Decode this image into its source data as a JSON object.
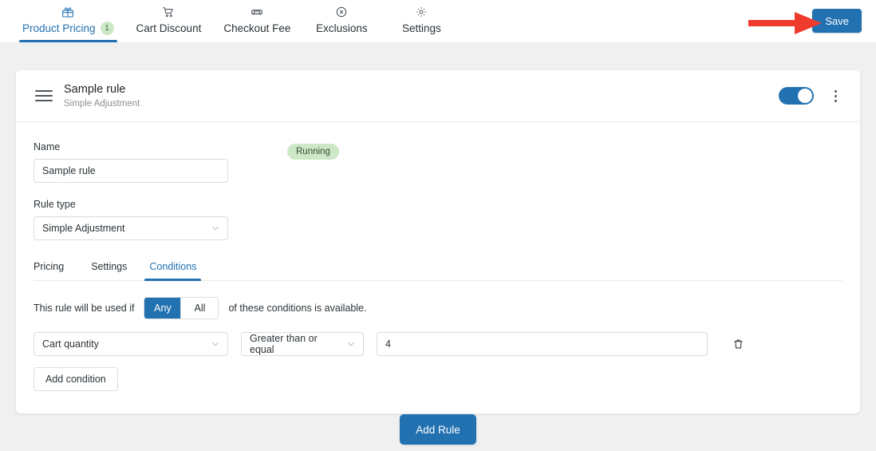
{
  "topbar": {
    "tabs": [
      {
        "label": "Product Pricing",
        "icon": "gift-icon",
        "count": "1",
        "active": true
      },
      {
        "label": "Cart Discount",
        "icon": "shopping-cart-icon",
        "count": "",
        "active": false
      },
      {
        "label": "Checkout Fee",
        "icon": "delivery-van-icon",
        "count": "",
        "active": false
      },
      {
        "label": "Exclusions",
        "icon": "circle-x-icon",
        "count": "",
        "active": false
      },
      {
        "label": "Settings",
        "icon": "gear-icon",
        "count": "",
        "active": false
      }
    ],
    "save_label": "Save",
    "accent_color": "#2271b1"
  },
  "annotation": {
    "arrow_color": "#ef3b2d",
    "arrow_target": "Save"
  },
  "rule_card": {
    "title": "Sample rule",
    "subtitle": "Simple Adjustment",
    "status_badge": "Running",
    "status_badge_bg": "#cde8c6",
    "toggle_on": true,
    "name_label": "Name",
    "name_value": "Sample rule",
    "name_placeholder": "Name",
    "rule_type_label": "Rule type",
    "rule_type_value": "Simple Adjustment",
    "inner_tabs": [
      {
        "label": "Pricing",
        "active": false
      },
      {
        "label": "Settings",
        "active": false
      },
      {
        "label": "Conditions",
        "active": true
      }
    ],
    "conditions": {
      "intro_prefix": "This rule will be used if",
      "match_options": [
        {
          "label": "Any",
          "selected": true
        },
        {
          "label": "All",
          "selected": false
        }
      ],
      "intro_suffix": "of these conditions is available.",
      "rows": [
        {
          "subject": "Cart quantity",
          "operator": "Greater than or equal",
          "value": "4",
          "value_placeholder": "",
          "delete_icon": "trash-icon"
        }
      ],
      "add_condition_label": "Add condition"
    }
  },
  "footer": {
    "add_rule_label": "Add Rule"
  }
}
